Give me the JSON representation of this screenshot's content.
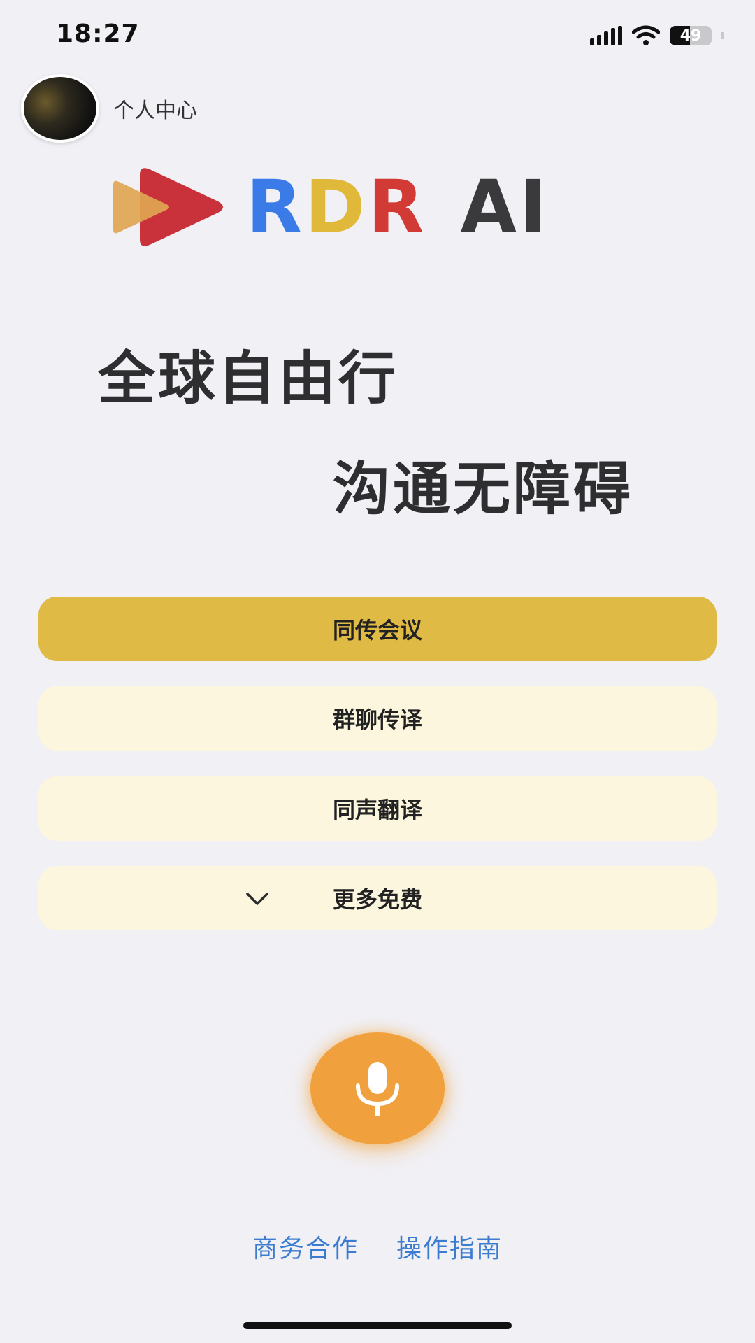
{
  "status_bar": {
    "time": "18:27",
    "battery_level": "49",
    "battery_fraction": 0.49
  },
  "profile": {
    "label": "个人中心"
  },
  "logo": {
    "part1": "R",
    "part2": "D",
    "part3": "R",
    "part4": "AI",
    "colors": {
      "blue": "#3a7be8",
      "yellow": "#e0b93a",
      "red": "#d23a35",
      "dark": "#3a3a3c"
    }
  },
  "slogan": {
    "line1": "全球自由行",
    "line2": "沟通无障碍"
  },
  "menu": {
    "items": [
      {
        "label": "同传会议",
        "active": true
      },
      {
        "label": "群聊传译",
        "active": false
      },
      {
        "label": "同声翻译",
        "active": false
      },
      {
        "label": "更多免费",
        "active": false
      }
    ],
    "active_color": "#dfba44",
    "inactive_color": "#fcf6df"
  },
  "mic": {
    "icon": "microphone-icon",
    "color": "#f0a03c"
  },
  "footer": {
    "business": "商务合作",
    "guide": "操作指南",
    "link_color": "#3c7cd0"
  }
}
